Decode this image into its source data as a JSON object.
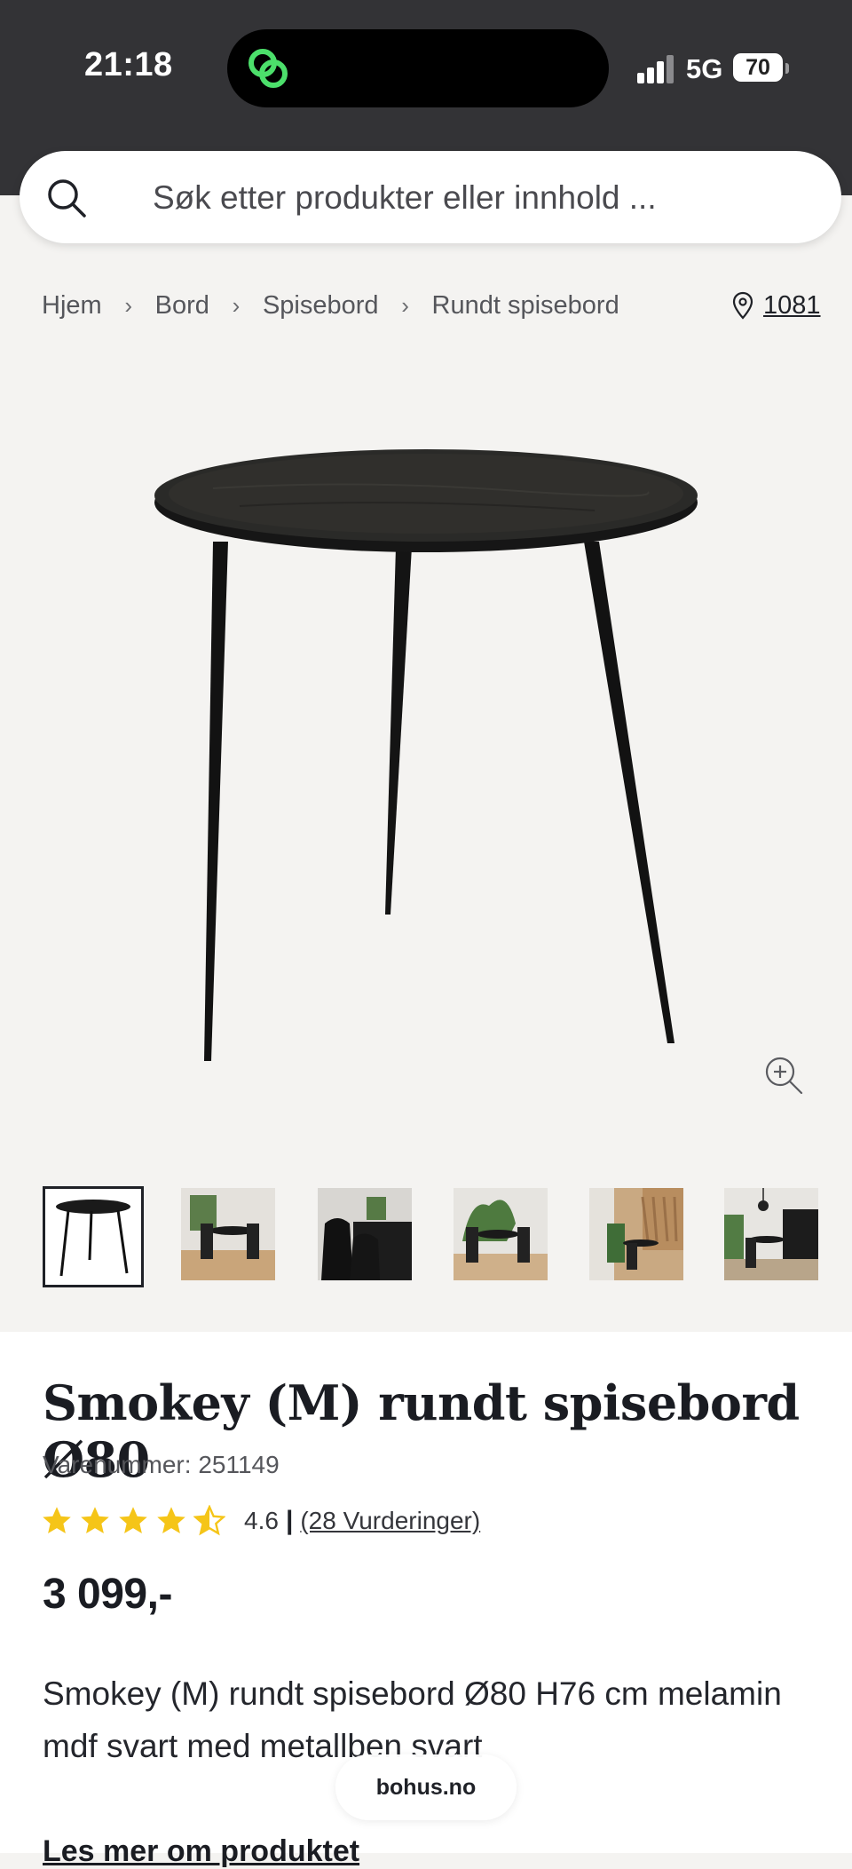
{
  "status": {
    "time": "21:18",
    "network": "5G",
    "battery": "70"
  },
  "search": {
    "placeholder": "Søk etter produkter eller innhold ..."
  },
  "breadcrumb": {
    "items": [
      "Hjem",
      "Bord",
      "Spisebord",
      "Rundt spisebord"
    ],
    "store": "1081"
  },
  "product": {
    "title": "Smokey (M) rundt spisebord Ø80",
    "sku": "Varenummer: 251149",
    "rating": 4.6,
    "rating_text": "4.6",
    "reviews": "(28 Vurderinger)",
    "price": "3 099,-",
    "description": "Smokey (M) rundt spisebord Ø80 H76 cm melamin mdf svart med metallben svart",
    "read_more": "Les mer om produktet"
  },
  "thumbnails": 6,
  "url_pill": "bohus.no",
  "colors": {
    "statusbar": "#333336",
    "background": "#f4f3f1",
    "star": "#f5c518",
    "text": "#1f2127"
  },
  "icons": [
    "search-icon",
    "chevron-right-icon",
    "location-pin-icon",
    "zoom-in-icon",
    "star-icon",
    "half-star-icon"
  ]
}
